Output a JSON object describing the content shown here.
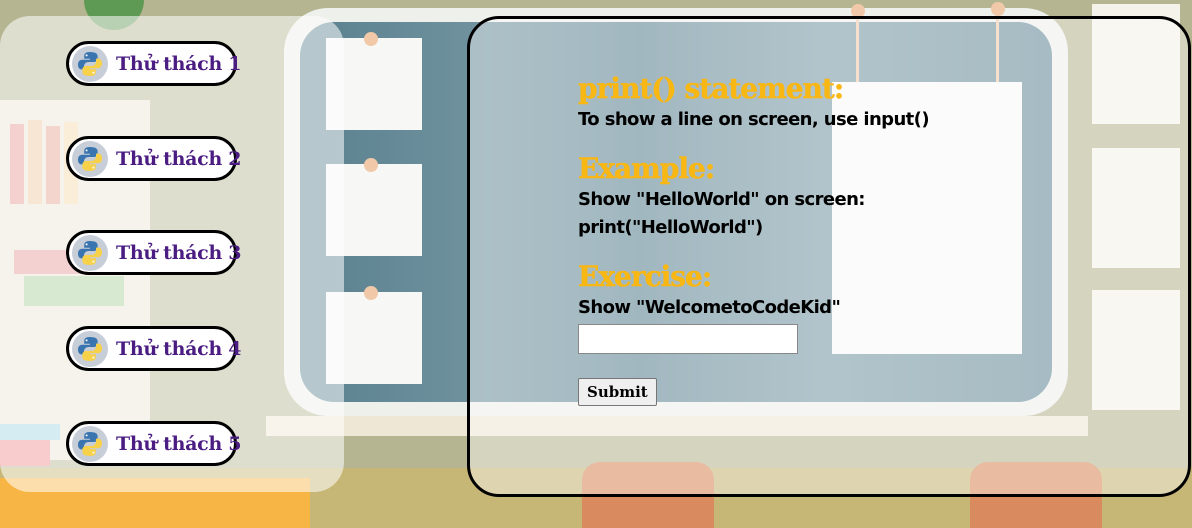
{
  "sidebar": {
    "challenges": [
      {
        "label": "Thử thách 1",
        "icon": "python-logo-icon"
      },
      {
        "label": "Thử thách 2",
        "icon": "python-logo-icon"
      },
      {
        "label": "Thử thách 3",
        "icon": "python-logo-icon"
      },
      {
        "label": "Thử thách 4",
        "icon": "python-logo-icon"
      },
      {
        "label": "Thử thách 5",
        "icon": "python-logo-icon"
      }
    ]
  },
  "lesson": {
    "title": "print() statement:",
    "description": "To show a line on screen, use input()",
    "example_heading": "Example:",
    "example_line1": "Show \"HelloWorld\" on screen:",
    "example_line2": "print(\"HelloWorld\")",
    "exercise_heading": "Exercise:",
    "exercise_prompt": "Show \"WelcometoCodeKid\"",
    "answer_value": "",
    "submit_label": "Submit"
  },
  "colors": {
    "heading": "#f9b714",
    "challenge_text": "#4b1d83",
    "python_blue": "#3a75b0",
    "python_yellow": "#f7d14a"
  }
}
